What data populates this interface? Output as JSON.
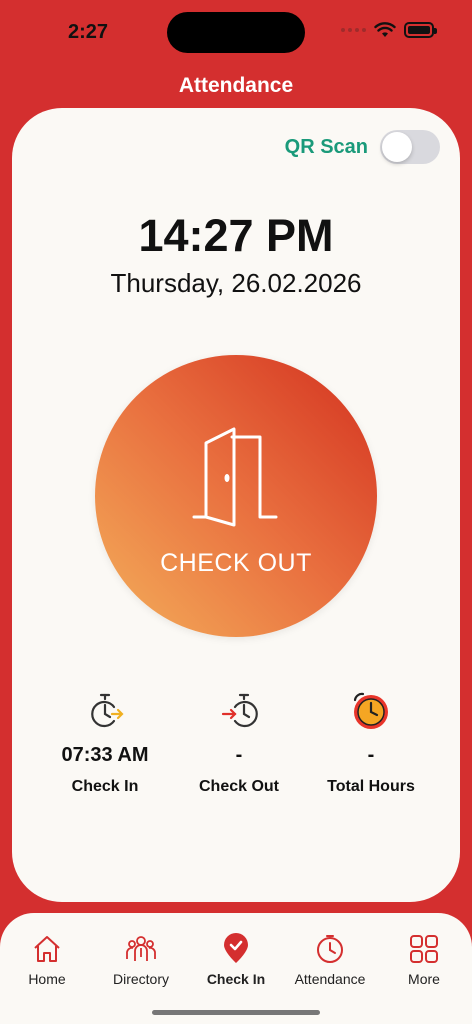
{
  "status": {
    "time": "2:27"
  },
  "header": {
    "title": "Attendance"
  },
  "qr": {
    "label": "QR Scan",
    "enabled": false
  },
  "clock": {
    "time": "14:27 PM",
    "date": "Thursday, 26.02.2026"
  },
  "action": {
    "label": "CHECK OUT",
    "icon": "door-open-icon"
  },
  "stats": [
    {
      "value": "07:33 AM",
      "label": "Check In",
      "icon": "check-in-timer-icon"
    },
    {
      "value": "-",
      "label": "Check Out",
      "icon": "check-out-timer-icon"
    },
    {
      "value": "-",
      "label": "Total Hours",
      "icon": "alarm-clock-icon"
    }
  ],
  "tabs": [
    {
      "label": "Home",
      "icon": "home-icon"
    },
    {
      "label": "Directory",
      "icon": "people-icon"
    },
    {
      "label": "Check In",
      "icon": "location-check-icon",
      "active": true
    },
    {
      "label": "Attendance",
      "icon": "clock-icon"
    },
    {
      "label": "More",
      "icon": "grid-icon"
    }
  ],
  "colors": {
    "brand": "#d42f2f",
    "accent_green": "#1a9a7a",
    "card_bg": "#fbf9f5"
  }
}
